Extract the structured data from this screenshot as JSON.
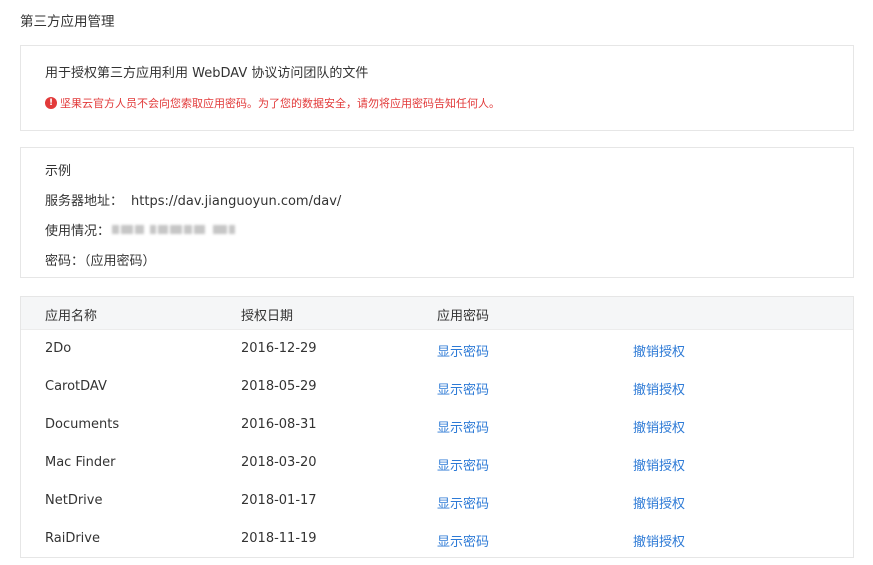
{
  "page": {
    "title": "第三方应用管理"
  },
  "info": {
    "description": "用于授权第三方应用利用 WebDAV 协议访问团队的文件",
    "warning_icon": "exclamation-circle-icon",
    "warning": "坚果云官方人员不会向您索取应用密码。为了您的数据安全，请勿将应用密码告知任何人。",
    "warning_color": "#e23a3a"
  },
  "example": {
    "heading": "示例",
    "server_label": "服务器地址：",
    "server_value": "https://dav.jianguoyun.com/dav/",
    "usage_label": "使用情况：",
    "password_label": "密码：",
    "password_value": "（应用密码）"
  },
  "table": {
    "headers": [
      "应用名称",
      "授权日期",
      "应用密码",
      ""
    ],
    "link_color": "#2d7ad6",
    "rows": [
      {
        "name": "2Do",
        "date": "2016-12-29",
        "show_password": "显示密码",
        "revoke": "撤销授权"
      },
      {
        "name": "CarotDAV",
        "date": "2018-05-29",
        "show_password": "显示密码",
        "revoke": "撤销授权"
      },
      {
        "name": "Documents",
        "date": "2016-08-31",
        "show_password": "显示密码",
        "revoke": "撤销授权"
      },
      {
        "name": "Mac Finder",
        "date": "2018-03-20",
        "show_password": "显示密码",
        "revoke": "撤销授权"
      },
      {
        "name": "NetDrive",
        "date": "2018-01-17",
        "show_password": "显示密码",
        "revoke": "撤销授权"
      },
      {
        "name": "RaiDrive",
        "date": "2018-11-19",
        "show_password": "显示密码",
        "revoke": "撤销授权"
      }
    ]
  }
}
